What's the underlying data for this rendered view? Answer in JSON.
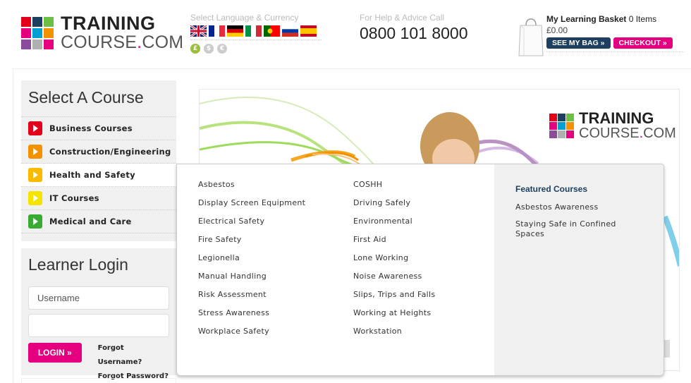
{
  "header": {
    "logo": {
      "line1": "TRAINING",
      "line2_a": "COURSE",
      "line2_dot": ".",
      "line2_b": "COM"
    },
    "language": {
      "title": "Select Language & Currency",
      "flags": [
        "gb-flag-icon",
        "fr-flag-icon",
        "de-flag-icon",
        "it-flag-icon",
        "pt-flag-icon",
        "ru-flag-icon",
        "es-flag-icon"
      ],
      "currencies": [
        "£",
        "$",
        "€"
      ]
    },
    "help": {
      "title": "For Help & Advice Call",
      "phone": "0800 101 8000"
    },
    "basket": {
      "title": "My Learning Basket",
      "items": "0 Items",
      "total": "£0.00",
      "see_bag": "SEE MY BAG »",
      "checkout": "CHECKOUT »"
    }
  },
  "sidebar": {
    "title": "Select A Course",
    "courses": [
      {
        "label": "Business Courses",
        "color": "#e2001a"
      },
      {
        "label": "Construction/Engineering",
        "color": "#f39200"
      },
      {
        "label": "Health and Safety",
        "color": "#fbba00"
      },
      {
        "label": "IT Courses",
        "color": "#f5e400"
      },
      {
        "label": "Medical and Care",
        "color": "#3aaa35"
      }
    ],
    "login": {
      "title": "Learner Login",
      "username_placeholder": "Username",
      "password_placeholder": "",
      "button": "LOGIN »",
      "forgot_username": "Forgot Username?",
      "forgot_password": "Forgot Password?"
    }
  },
  "banner": {
    "logo": {
      "line1": "TRAINING",
      "line2_a": "COURSE",
      "line2_dot": ".",
      "line2_b": "COM"
    }
  },
  "dropdown": {
    "col1": [
      "Asbestos",
      "Display Screen Equipment",
      "Electrical Safety",
      "Fire Safety",
      "Legionella",
      "Manual Handling",
      "Risk Assessment",
      "Stress Awareness",
      "Workplace Safety"
    ],
    "col2": [
      "COSHH",
      "Driving Safely",
      "Environmental",
      "First Aid",
      "Lone Working",
      "Noise Awareness",
      "Slips, Trips and Falls",
      "Working at Heights",
      "Workstation"
    ],
    "featured": {
      "title": "Featured Courses",
      "items": [
        "Asbestos Awareness",
        "Staying Safe in Confined Spaces"
      ]
    }
  },
  "colors": {
    "brand_pink": "#e4007f",
    "brand_navy": "#1d4060",
    "logo_squares": [
      "#e2001a",
      "#1d4060",
      "#6cbe45",
      "#e4007f",
      "#00a0d2",
      "#f39200",
      "#8a4c9b",
      "#b0b0b0",
      "#e4007f"
    ]
  }
}
